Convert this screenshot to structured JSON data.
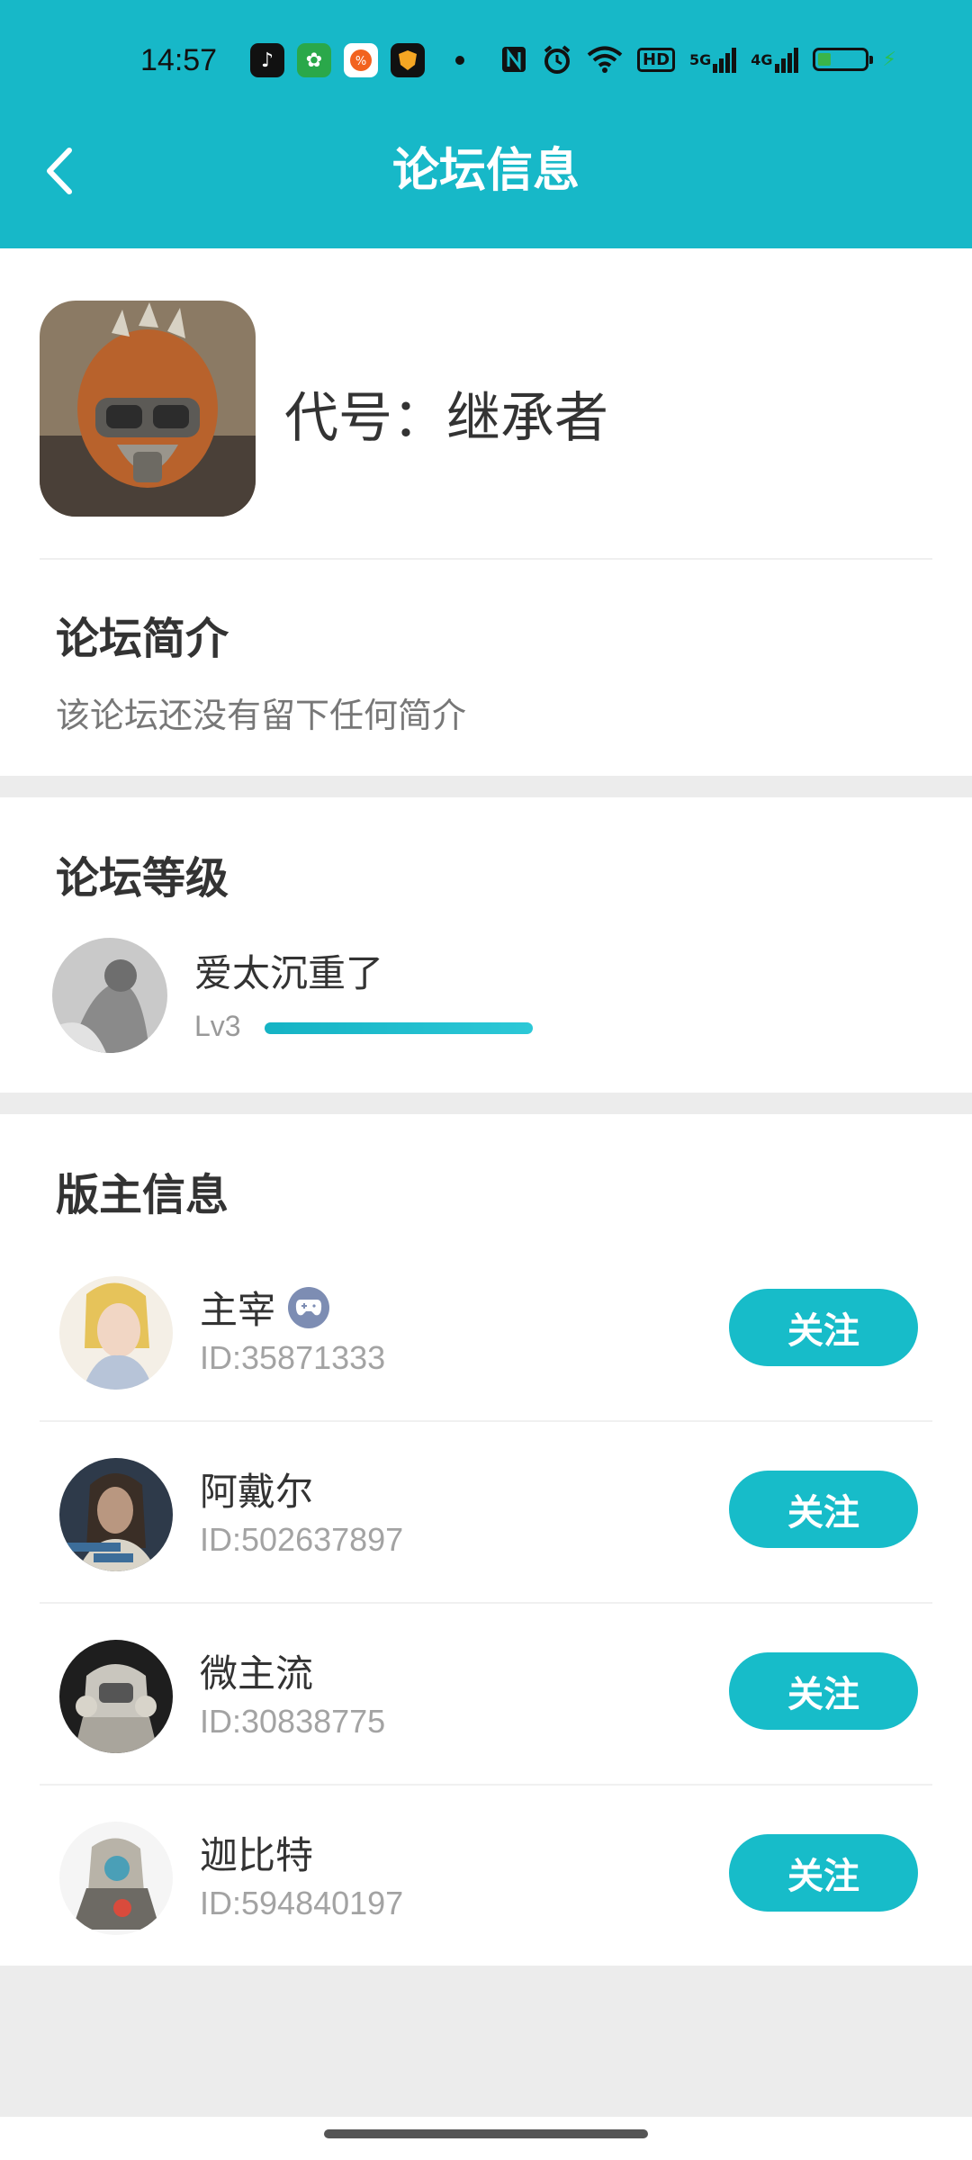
{
  "status_bar": {
    "time": "14:57",
    "app_icons": [
      "tiktok-icon",
      "game-app-icon",
      "shopping-app-icon",
      "shield-app-icon"
    ],
    "indicators": [
      "nfc-icon",
      "alarm-icon",
      "wifi-icon",
      "hd-icon",
      "signal-5g-icon",
      "signal-4g-icon",
      "battery-icon",
      "charging-icon"
    ],
    "hd_text": "HD",
    "net1": "5G",
    "net2": "4G"
  },
  "header": {
    "title": "论坛信息",
    "back_icon": "chevron-left-icon",
    "bg_color": "#17b8c8"
  },
  "forum": {
    "name": "代号：继承者"
  },
  "intro": {
    "title": "论坛简介",
    "text": "该论坛还没有留下任何简介"
  },
  "level": {
    "title": "论坛等级",
    "user_name": "爱太沉重了",
    "level_label": "Lv3",
    "progress": 1.0
  },
  "moderators": {
    "title": "版主信息",
    "follow_label": "关注",
    "items": [
      {
        "name": "主宰",
        "id": "ID:35871333",
        "badge": "gamepad-icon"
      },
      {
        "name": "阿戴尔",
        "id": "ID:502637897"
      },
      {
        "name": "微主流",
        "id": "ID:30838775"
      },
      {
        "name": "迦比特",
        "id": "ID:594840197"
      }
    ]
  },
  "colors": {
    "accent": "#17bcc9",
    "badge": "#7d8db3",
    "page_bg": "#ececec"
  }
}
